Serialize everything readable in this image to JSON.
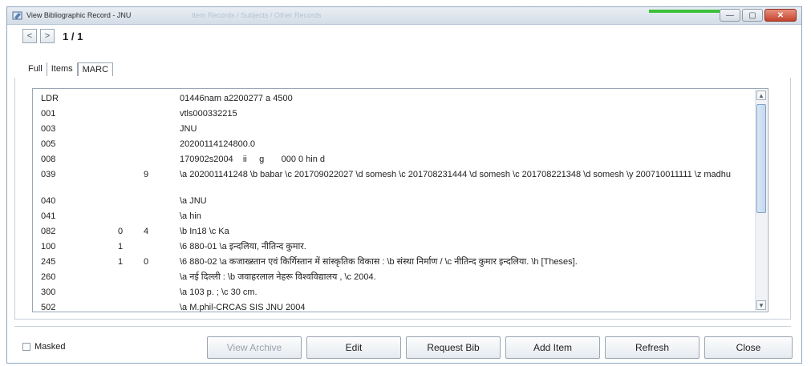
{
  "window": {
    "title": "View Bibliographic Record - JNU",
    "ghost_title": "Item Records / Subjects / Other Records",
    "controls": {
      "minimize": "—",
      "maximize": "▢",
      "close": "✕"
    }
  },
  "nav": {
    "prev": "<",
    "next": ">",
    "pager": "1 / 1"
  },
  "tabs": [
    {
      "label": "Full"
    },
    {
      "label": "Items"
    },
    {
      "label": "MARC"
    }
  ],
  "marc_rows": [
    {
      "tag": "LDR",
      "i1": "",
      "i2": "",
      "value": "01446nam a2200277 a 4500"
    },
    {
      "tag": "001",
      "i1": "",
      "i2": "",
      "value": "vtls000332215"
    },
    {
      "tag": "003",
      "i1": "",
      "i2": "",
      "value": "JNU"
    },
    {
      "tag": "005",
      "i1": "",
      "i2": "",
      "value": "20200114124800.0"
    },
    {
      "tag": "008",
      "i1": "",
      "i2": "",
      "value": "170902s2004    ii     g       000 0 hin d"
    },
    {
      "tag": "039",
      "i1": "",
      "i2": "9",
      "value": "\\a 202001141248 \\b babar \\c 201709022027 \\d somesh \\c 201708231444 \\d somesh \\c 201708221348 \\d somesh \\y 200710011111 \\z madhu"
    },
    {
      "tag": "040",
      "i1": "",
      "i2": "",
      "value": "\\a JNU"
    },
    {
      "tag": "041",
      "i1": "",
      "i2": "",
      "value": "\\a hin"
    },
    {
      "tag": "082",
      "i1": "0",
      "i2": "4",
      "value": "\\b In18 \\c Ka"
    },
    {
      "tag": "100",
      "i1": "1",
      "i2": "",
      "value": "\\6 880-01 \\a इन्दलिया, नीतिन्द कुमार."
    },
    {
      "tag": "245",
      "i1": "1",
      "i2": "0",
      "value": "\\6 880-02 \\a कजाख्स्तान एवं किर्गिस्तान में सांस्कृतिक विकास : \\b संस्था निर्माण / \\c नीतिन्द कुमार इन्दलिया. \\h [Theses]."
    },
    {
      "tag": "260",
      "i1": "",
      "i2": "",
      "value": "\\a नई दिल्ली : \\b जवाहरलाल नेहरू विश्वविद्यालय , \\c 2004."
    },
    {
      "tag": "300",
      "i1": "",
      "i2": "",
      "value": "\\a 103 p. ; \\c 30 cm."
    },
    {
      "tag": "502",
      "i1": "",
      "i2": "",
      "value": "\\a M.phil-CRCAS SIS JNU 2004"
    }
  ],
  "footer": {
    "masked_label": "Masked",
    "buttons": {
      "view_archive": "View Archive",
      "edit": "Edit",
      "request_bib": "Request Bib",
      "add_item": "Add Item",
      "refresh": "Refresh",
      "close": "Close"
    }
  },
  "colors": {
    "accent": "#3cc03c",
    "scroll_thumb": "#c3d7ee",
    "close_button": "#c4432c"
  }
}
